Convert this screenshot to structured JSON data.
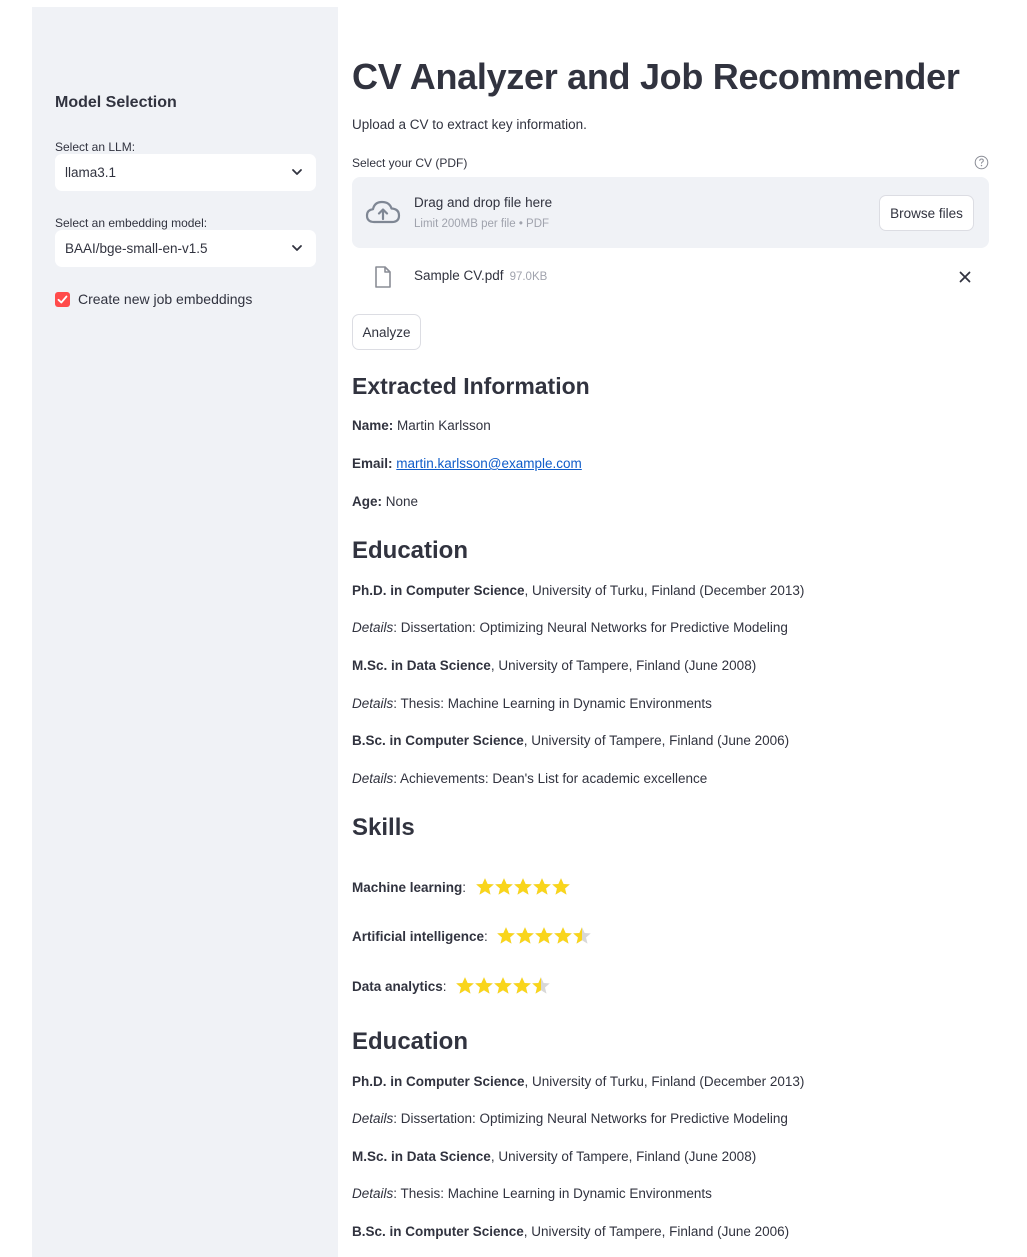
{
  "sidebar": {
    "title": "Model Selection",
    "llm_label": "Select an LLM:",
    "llm_value": "llama3.1",
    "embedding_label": "Select an embedding model:",
    "embedding_value": "BAAI/bge-small-en-v1.5",
    "checkbox_label": "Create new job embeddings",
    "checkbox_checked": true
  },
  "main": {
    "title": "CV Analyzer and Job Recommender",
    "intro": "Upload a CV to extract key information.",
    "uploader": {
      "label": "Select your CV (PDF)",
      "drop_text": "Drag and drop file here",
      "limit_text": "Limit 200MB per file • PDF",
      "browse_label": "Browse files",
      "file_name": "Sample CV.pdf",
      "file_size": "97.0KB"
    },
    "analyze_label": "Analyze",
    "extracted": {
      "heading": "Extracted Information",
      "name_label": "Name:",
      "name_value": "Martin Karlsson",
      "email_label": "Email:",
      "email_value": "martin.karlsson@example.com",
      "age_label": "Age:",
      "age_value": "None"
    },
    "education_heading": "Education",
    "education": [
      {
        "degree": "Ph.D. in Computer Science",
        "rest": ", University of Turku, Finland (December 2013)",
        "details_label": "Details",
        "details": ": Dissertation: Optimizing Neural Networks for Predictive Modeling"
      },
      {
        "degree": "M.Sc. in Data Science",
        "rest": ", University of Tampere, Finland (June 2008)",
        "details_label": "Details",
        "details": ": Thesis: Machine Learning in Dynamic Environments"
      },
      {
        "degree": "B.Sc. in Computer Science",
        "rest": ", University of Tampere, Finland (June 2006)",
        "details_label": "Details",
        "details": ": Achievements: Dean's List for academic excellence"
      }
    ],
    "skills_heading": "Skills",
    "skills": [
      {
        "name": "Machine learning",
        "rating": 5
      },
      {
        "name": "Artificial intelligence",
        "rating": 4.5
      },
      {
        "name": "Data analytics",
        "rating": 4.5
      }
    ],
    "education2_heading": "Education",
    "star_color": "#f9d51b",
    "star_empty_color": "#d8d8d8",
    "accent_color": "#ff4b4b"
  }
}
